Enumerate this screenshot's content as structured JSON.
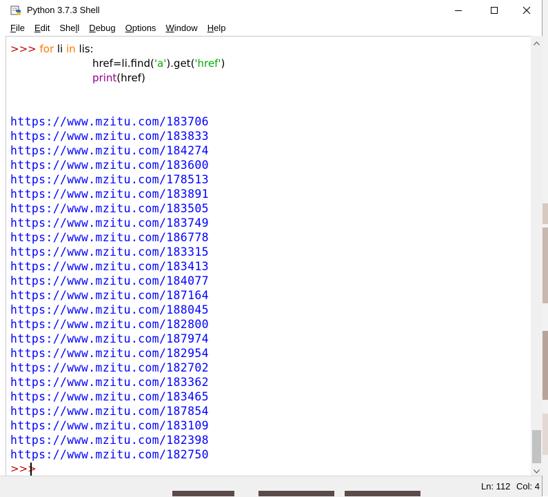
{
  "window": {
    "title": "Python 3.7.3 Shell"
  },
  "menu": [
    {
      "label": "File",
      "u": "F",
      "rest": "ile"
    },
    {
      "label": "Edit",
      "u": "E",
      "rest": "dit"
    },
    {
      "label": "Shell",
      "pre": "She",
      "u": "l",
      "rest": "l"
    },
    {
      "label": "Debug",
      "u": "D",
      "rest": "ebug"
    },
    {
      "label": "Options",
      "u": "O",
      "rest": "ptions"
    },
    {
      "label": "Window",
      "u": "W",
      "rest": "indow"
    },
    {
      "label": "Help",
      "u": "H",
      "rest": "elp"
    }
  ],
  "code": {
    "prompt": ">>> ",
    "line1": {
      "kw_for": "for",
      "var": " li ",
      "kw_in": "in",
      "rest": " lis:"
    },
    "line2": {
      "pre": "href=li.find(",
      "s1": "'a'",
      "mid": ").get(",
      "s2": "'href'",
      "post": ")"
    },
    "line3": {
      "fn": "print",
      "args": "(href)"
    }
  },
  "output": [
    "https://www.mzitu.com/183706",
    "https://www.mzitu.com/183833",
    "https://www.mzitu.com/184274",
    "https://www.mzitu.com/183600",
    "https://www.mzitu.com/178513",
    "https://www.mzitu.com/183891",
    "https://www.mzitu.com/183505",
    "https://www.mzitu.com/183749",
    "https://www.mzitu.com/186778",
    "https://www.mzitu.com/183315",
    "https://www.mzitu.com/183413",
    "https://www.mzitu.com/184077",
    "https://www.mzitu.com/187164",
    "https://www.mzitu.com/188045",
    "https://www.mzitu.com/182800",
    "https://www.mzitu.com/187974",
    "https://www.mzitu.com/182954",
    "https://www.mzitu.com/182702",
    "https://www.mzitu.com/183362",
    "https://www.mzitu.com/183465",
    "https://www.mzitu.com/187854",
    "https://www.mzitu.com/183109",
    "https://www.mzitu.com/182398",
    "https://www.mzitu.com/182750"
  ],
  "final_prompt": ">>>",
  "status": {
    "line": "Ln: 112",
    "col": "Col: 4"
  },
  "colors": {
    "prompt": "#c00000",
    "keyword": "#ff7700",
    "builtin": "#900090",
    "string": "#00aa00",
    "output": "#0000ff"
  },
  "icons": {
    "app": "python-idle-icon",
    "minimize": "minimize-icon",
    "maximize": "maximize-icon",
    "close": "close-icon",
    "scroll_up": "scroll-up-arrow-icon",
    "scroll_down": "scroll-down-arrow-icon"
  }
}
